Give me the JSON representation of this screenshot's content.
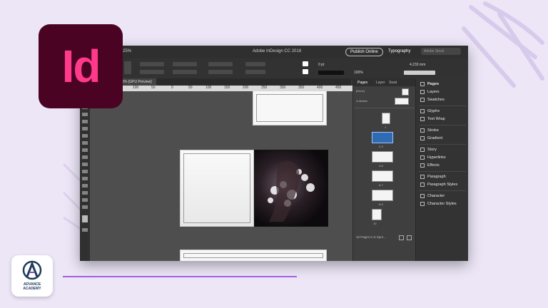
{
  "window": {
    "title": "Adobe InDesign CC 2018",
    "zoom": "25%",
    "publish_label": "Publish Online",
    "workspace_label": "Typography",
    "search_placeholder": "Adobe Stock",
    "stroke_weight": "0 pt",
    "width_value": "4.233 mm",
    "opacity_value": "100%",
    "doc_tab": "@ 25% [GPU Preview]"
  },
  "ruler": [
    "150",
    "100",
    "50",
    "0",
    "50",
    "100",
    "150",
    "200",
    "250",
    "300",
    "350",
    "400",
    "450"
  ],
  "pages_panel": {
    "tabs": [
      "Pages",
      "Layer",
      "Swat"
    ],
    "none_label": "[None]",
    "master_label": "A-Master",
    "spread_labels": [
      "1",
      "2-3",
      "4-5",
      "6-7",
      "8-9",
      "10"
    ],
    "footer": "10 Pages in 6 Spre..."
  },
  "right_panel": {
    "items": [
      "Pages",
      "Layers",
      "Swatches",
      "Glyphs",
      "Text Wrap",
      "Stroke",
      "Gradient",
      "Story",
      "Hyperlinks",
      "Effects",
      "Paragraph",
      "Paragraph Styles",
      "Character",
      "Character Styles"
    ]
  },
  "logo": {
    "text": "Id",
    "bg": "#4a0322",
    "fg": "#ff3a8a"
  },
  "academy": {
    "line1": "ADVANCE",
    "line2": "ACADEMY"
  },
  "colors": {
    "accent": "#a45edb",
    "selected_spread": "#2f6bb3"
  }
}
